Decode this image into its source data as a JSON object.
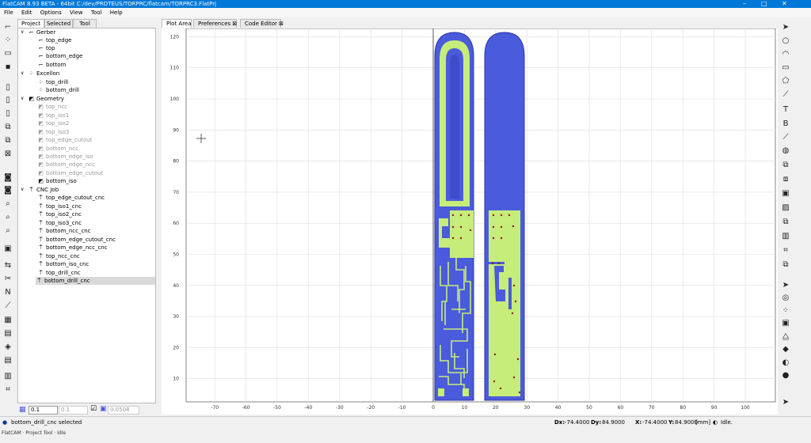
{
  "window": {
    "title": "FlatCAM 8.93 BETA - 64bit    C:/dev/PROTEUS/TORPRC/flatcam/TORPRC3.FlatPrj",
    "min": "–",
    "max": "□",
    "close": "✕"
  },
  "menu": [
    "File",
    "Edit",
    "Options",
    "View",
    "Tool",
    "Help"
  ],
  "left_tabs": [
    "Project",
    "Selected",
    "Tool"
  ],
  "plot_tabs": [
    "Plot Area",
    "Preferences",
    "Code Editor"
  ],
  "tree": {
    "gerber": {
      "label": "Gerber",
      "items": [
        "top_edge",
        "top",
        "bottom_edge",
        "bottom"
      ]
    },
    "excellon": {
      "label": "Excellon",
      "items": [
        "top_drill",
        "bottom_drill"
      ]
    },
    "geometry": {
      "label": "Geometry",
      "items": [
        "top_ncc",
        "top_iso1",
        "top_iso2",
        "top_iso3",
        "top_edge_cutout",
        "bottom_ncc",
        "bottom_edge_iso",
        "bottom_edge_ncc",
        "bottom_edge_cutout",
        "bottom_iso"
      ]
    },
    "cnc": {
      "label": "CNC Job",
      "items": [
        "top_edge_cutout_cnc",
        "top_iso1_cnc",
        "top_iso2_cnc",
        "top_iso3_cnc",
        "bottom_ncc_cnc",
        "bottom_edge_cutout_cnc",
        "bottom_edge_ncc_cnc",
        "top_ncc_cnc",
        "bottom_iso_cnc",
        "top_drill_cnc",
        "bottom_drill_cnc"
      ]
    }
  },
  "bottom_left": {
    "snap_value": "0.1",
    "snap_value2": "0.1",
    "value3": "0.0508"
  },
  "axes": {
    "x_ticks": [
      "-70",
      "-60",
      "-50",
      "-40",
      "-30",
      "-20",
      "-10",
      "0",
      "10",
      "20",
      "30",
      "40",
      "50",
      "60",
      "70",
      "80",
      "90",
      "100"
    ],
    "y_ticks": [
      "10",
      "20",
      "30",
      "40",
      "50",
      "60",
      "70",
      "80",
      "90",
      "100",
      "110",
      "120"
    ]
  },
  "status": {
    "message": "bottom_drill_cnc selected",
    "dx_label": "Dx:",
    "dx": "-74.4000",
    "dy_label": "Dy:",
    "dy": "84.9000",
    "x_label": "X:",
    "x": "-74.4000",
    "y_label": "Y:",
    "y": "84.9000",
    "units": "[mm]",
    "state": "Idle."
  },
  "footer_text": "FlatCAM · Project Tool · Idle",
  "colors": {
    "copper": "#4a5bdc",
    "pcb": "#c6ec7a",
    "accent": "#0078d7"
  }
}
